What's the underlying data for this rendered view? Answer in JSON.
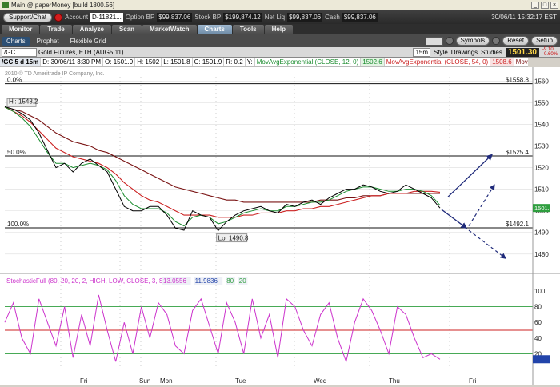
{
  "window": {
    "title": "Main @ paperMoney [build 1800.56]"
  },
  "account": {
    "support_label": "Support/Chat",
    "account_label": "Account",
    "account_value": "D-11821...",
    "option_bp_label": "Option BP",
    "option_bp": "$99,837.06",
    "stock_bp_label": "Stock BP",
    "stock_bp": "$199,874.12",
    "net_liq_label": "Net Liq",
    "net_liq": "$99,837.06",
    "cash_label": "Cash",
    "cash": "$99,837.06",
    "datetime": "30/06/11 15:32:17 EST"
  },
  "main_tabs": [
    "Monitor",
    "Trade",
    "Analyze",
    "Scan",
    "MarketWatch",
    "Charts",
    "Tools",
    "Help"
  ],
  "active_main_tab": "Charts",
  "sub_tabs": [
    "Charts",
    "Prophet",
    "Flexible Grid"
  ],
  "toolbar": {
    "symbols": "Symbols",
    "reset": "Reset",
    "setup": "Setup"
  },
  "symbol_bar": {
    "symbol": "/GC",
    "description": "Gold Futures, ETH (AUG5 11)",
    "timeframe": "15m",
    "style": "Style",
    "drawings": "Drawings",
    "studies": "Studies",
    "last": "1501.30",
    "change": "-9.10",
    "change_pct": "-0.60%"
  },
  "info_bar": {
    "ticker": "/GC 5 d 15m",
    "date": "D: 30/06/11 3:30 PM",
    "open": "O: 1501.9",
    "high": "H: 1502",
    "low": "L: 1501.8",
    "close": "C: 1501.9",
    "range": "R: 0.2",
    "y": "Y:",
    "ma1": "MovAvgExponential (CLOSE, 12, 0)",
    "ma1_value": "1502.6",
    "ma2": "MovAvgExponential (CLOSE, 54, 0)",
    "ma2_value": "1508.6",
    "ma3": "MovAvgExponential (CL..."
  },
  "copyright": "2010 © TD Ameritrade IP Company, Inc.",
  "colors": {
    "price": "#000000",
    "ema12": "#1a8c2e",
    "ema54": "#cc2222",
    "ema100": "#7a1414",
    "stochastic": "#cc33cc",
    "arrows": "#1f2a7a",
    "fib_levels": "#111111"
  },
  "chart_data": [
    {
      "type": "line",
      "title": "/GC 5 d 15m",
      "y_axis_ticks": [
        1480,
        1490,
        1500,
        1510,
        1520,
        1530,
        1540,
        1550,
        1560
      ],
      "ylim": [
        1474,
        1562
      ],
      "x_axis_labels": [
        "Fri",
        "Sun",
        "Mon",
        "Tue",
        "Wed",
        "Thu",
        "Fri"
      ],
      "fib_levels": [
        {
          "label": "0.0%",
          "value": 1558.8,
          "value_label": "$1558.8"
        },
        {
          "label": "50.0%",
          "value": 1525.4,
          "value_label": "$1525.4"
        },
        {
          "label": "100.0%",
          "value": 1492.1,
          "value_label": "$1492.1"
        }
      ],
      "annotations": [
        {
          "text": "Hi: 1548.2",
          "value": 1548.2
        },
        {
          "text": "Lo: 1490.8",
          "value": 1490.8
        }
      ],
      "last_price_marker": "1501.3",
      "price": [
        1548.2,
        1547,
        1545,
        1542,
        1536,
        1528,
        1520,
        1522,
        1518,
        1522,
        1524,
        1521,
        1518,
        1510,
        1502,
        1500,
        1500,
        1502,
        1502,
        1498,
        1492,
        1491,
        1500,
        1498,
        1497,
        1490.8,
        1495,
        1498,
        1500,
        1501,
        1502,
        1500,
        1499,
        1503,
        1502,
        1504,
        1505,
        1503,
        1506,
        1508,
        1510,
        1510,
        1512,
        1511,
        1509,
        1508,
        1509,
        1512,
        1510,
        1508,
        1506,
        1501.3
      ],
      "ema12": [
        1548,
        1546,
        1543,
        1539,
        1533,
        1527,
        1522,
        1522,
        1520,
        1521,
        1522,
        1521,
        1519,
        1514,
        1507,
        1503,
        1501,
        1501,
        1501,
        1499,
        1495,
        1493,
        1497,
        1498,
        1497,
        1494,
        1495,
        1497,
        1499,
        1500,
        1501,
        1500,
        1500,
        1502,
        1502,
        1503,
        1504,
        1504,
        1505,
        1507,
        1509,
        1510,
        1511,
        1511,
        1510,
        1509,
        1509,
        1510,
        1510,
        1509,
        1507,
        1502.6
      ],
      "ema54": [
        1548,
        1546,
        1544,
        1541,
        1537,
        1533,
        1529,
        1527,
        1525,
        1524,
        1523,
        1522,
        1520,
        1517,
        1513,
        1510,
        1507,
        1505,
        1504,
        1502,
        1500,
        1498,
        1498,
        1498,
        1498,
        1497,
        1497,
        1497,
        1498,
        1498,
        1499,
        1499,
        1499,
        1500,
        1500,
        1501,
        1501,
        1502,
        1502,
        1503,
        1504,
        1505,
        1506,
        1507,
        1507,
        1508,
        1508,
        1508,
        1509,
        1509,
        1509,
        1508.6
      ],
      "ema100": [
        1548,
        1547,
        1546,
        1544,
        1542,
        1539,
        1536,
        1534,
        1532,
        1531,
        1530,
        1528,
        1527,
        1525,
        1523,
        1521,
        1519,
        1517,
        1515,
        1513,
        1511,
        1510,
        1509,
        1508,
        1507,
        1506,
        1505,
        1505,
        1504,
        1504,
        1504,
        1504,
        1504,
        1504,
        1504,
        1504,
        1504,
        1505,
        1505,
        1505,
        1506,
        1506,
        1507,
        1507,
        1507,
        1508,
        1508,
        1508,
        1508,
        1508,
        1508,
        1508
      ]
    },
    {
      "type": "line",
      "title": "StochasticFull (80, 20, 20, 2, HIGH, LOW, CLOSE, 3, SMA)",
      "values_label": [
        "13.0556",
        "11.9836",
        "80",
        "20"
      ],
      "y_axis_ticks": [
        20,
        40,
        60,
        80,
        100
      ],
      "ylim": [
        0,
        100
      ],
      "levels": [
        80,
        20
      ],
      "values": [
        60,
        85,
        40,
        20,
        90,
        60,
        30,
        80,
        15,
        70,
        30,
        95,
        50,
        10,
        60,
        20,
        80,
        40,
        85,
        70,
        30,
        20,
        75,
        90,
        55,
        20,
        85,
        60,
        20,
        90,
        40,
        70,
        15,
        90,
        80,
        50,
        30,
        70,
        85,
        40,
        10,
        60,
        90,
        75,
        50,
        20,
        80,
        70,
        40,
        15,
        20,
        13
      ]
    }
  ]
}
